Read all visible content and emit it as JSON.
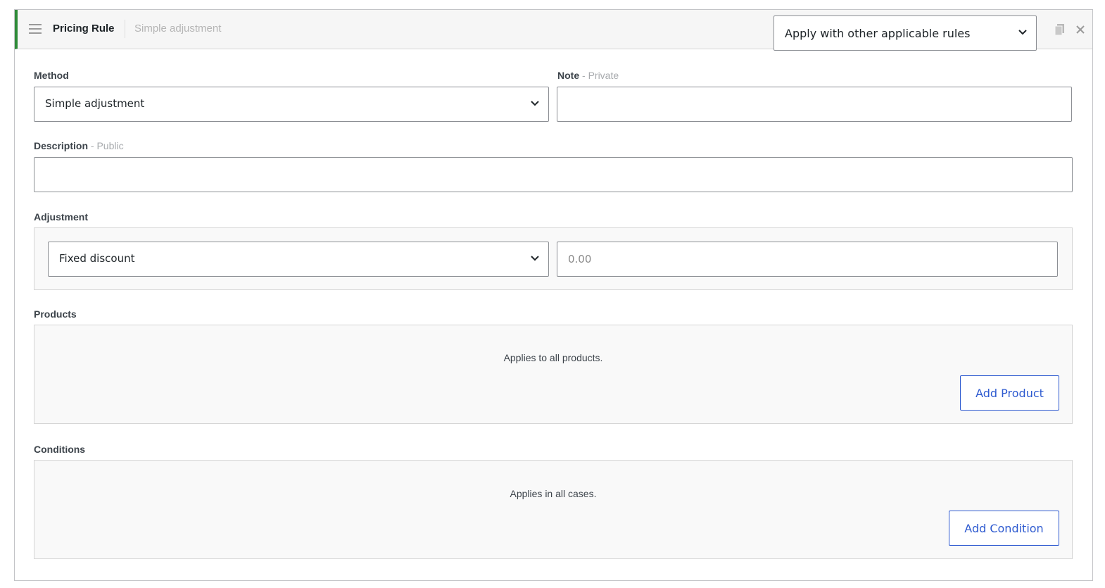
{
  "header": {
    "title": "Pricing Rule",
    "subtitle": "Simple adjustment",
    "apply_mode": "Apply with other applicable rules"
  },
  "method": {
    "label": "Method",
    "value": "Simple adjustment"
  },
  "note": {
    "label": "Note",
    "hint": "- Private",
    "value": ""
  },
  "description": {
    "label": "Description",
    "hint": "- Public",
    "value": ""
  },
  "adjustment": {
    "label": "Adjustment",
    "type": "Fixed discount",
    "amount_placeholder": "0.00"
  },
  "products": {
    "label": "Products",
    "empty_text": "Applies to all products.",
    "add_button": "Add Product"
  },
  "conditions": {
    "label": "Conditions",
    "empty_text": "Applies in all cases.",
    "add_button": "Add Condition"
  },
  "colors": {
    "accent_bar": "#2e8b38",
    "button_blue": "#2f5bd0"
  },
  "icons": [
    "drag-handle-icon",
    "chevron-down-icon",
    "copy-icon",
    "close-icon"
  ]
}
